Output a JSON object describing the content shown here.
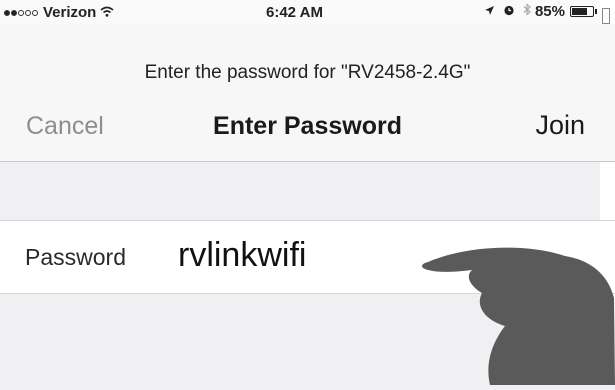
{
  "status_bar": {
    "signal_bars_filled": 2,
    "signal_bars_total": 5,
    "carrier": "Verizon",
    "wifi_icon": "wifi-icon",
    "time": "6:42 AM",
    "location_icon": "location-arrow-icon",
    "alarm_icon": "alarm-clock-icon",
    "bluetooth_icon": "bluetooth-icon",
    "battery_percent": "85%",
    "battery_level": 0.85
  },
  "header": {
    "prompt": "Enter the password for \"RV2458-2.4G\"",
    "cancel_label": "Cancel",
    "title": "Enter Password",
    "join_label": "Join"
  },
  "form": {
    "password_label": "Password",
    "password_value": "rvlinkwifi"
  },
  "overlay": {
    "pointer_icon": "pointing-hand-icon"
  }
}
